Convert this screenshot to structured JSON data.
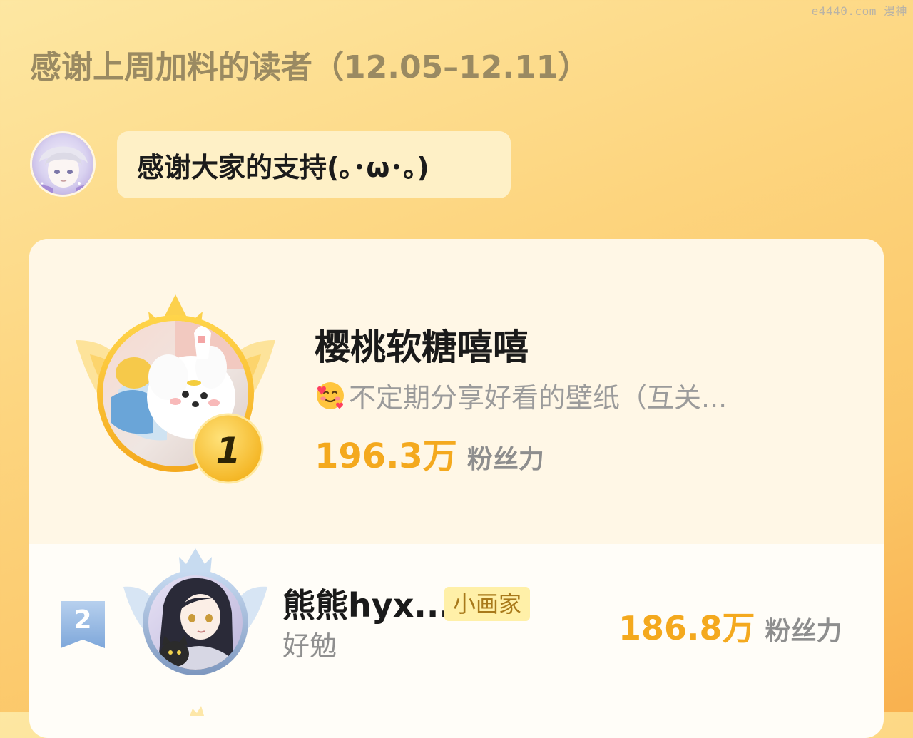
{
  "watermark": "e4440.com 漫神",
  "header": {
    "title": "感谢上周加料的读者（12.05–12.11）"
  },
  "author_message": {
    "text": "感谢大家的支持(｡･ω･｡)"
  },
  "ranking": {
    "first": {
      "rank": "1",
      "name": "樱桃软糖嘻嘻",
      "description": "不定期分享好看的壁纸（互关...",
      "fans_value": "196.3万",
      "fans_unit": "粉丝力"
    },
    "second": {
      "rank": "2",
      "name": "熊熊hyx...",
      "tag": "小画家",
      "description": "好勉",
      "fans_value": "186.8万",
      "fans_unit": "粉丝力"
    }
  },
  "colors": {
    "accent_orange": "#f4a91e",
    "gold": "#f5c43a",
    "silver_blue": "#8eb4e0"
  },
  "icons": {
    "first_place_badge": "gold-crown-wings-icon",
    "second_place_badge": "silver-crown-wings-icon",
    "rank_ribbon": "rank-ribbon-icon",
    "smiling_face": "smiling-face-with-hearts-icon"
  }
}
